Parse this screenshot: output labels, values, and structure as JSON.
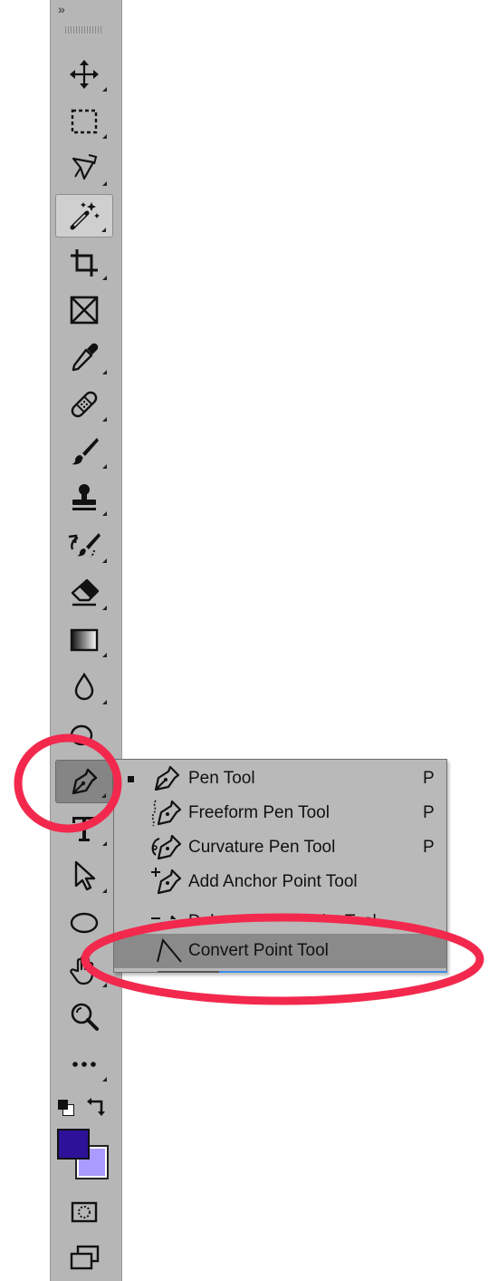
{
  "toolbar": {
    "collapse_label": "»",
    "tools": [
      {
        "name": "move-tool",
        "icon": "move-icon"
      },
      {
        "name": "rectangular-marquee-tool",
        "icon": "marquee-icon"
      },
      {
        "name": "lasso-tool",
        "icon": "lasso-icon"
      },
      {
        "name": "magic-wand-tool",
        "icon": "magic-wand-icon",
        "state": "active"
      },
      {
        "name": "crop-tool",
        "icon": "crop-icon"
      },
      {
        "name": "frame-tool",
        "icon": "frame-icon"
      },
      {
        "name": "eyedropper-tool",
        "icon": "eyedropper-icon"
      },
      {
        "name": "healing-brush-tool",
        "icon": "bandage-icon"
      },
      {
        "name": "brush-tool",
        "icon": "brush-icon"
      },
      {
        "name": "clone-stamp-tool",
        "icon": "stamp-icon"
      },
      {
        "name": "history-brush-tool",
        "icon": "history-brush-icon"
      },
      {
        "name": "eraser-tool",
        "icon": "eraser-icon"
      },
      {
        "name": "gradient-tool",
        "icon": "gradient-icon"
      },
      {
        "name": "blur-tool",
        "icon": "drop-icon"
      },
      {
        "name": "dodge-tool",
        "icon": "dodge-icon"
      },
      {
        "name": "pen-tool",
        "icon": "pen-icon",
        "state": "pressed"
      },
      {
        "name": "type-tool",
        "icon": "type-icon"
      },
      {
        "name": "path-selection-tool",
        "icon": "arrow-icon"
      },
      {
        "name": "ellipse-tool",
        "icon": "ellipse-icon"
      },
      {
        "name": "hand-tool",
        "icon": "hand-icon"
      },
      {
        "name": "zoom-tool",
        "icon": "zoom-icon"
      },
      {
        "name": "edit-toolbar",
        "icon": "more-icon"
      }
    ],
    "foreground_color": "#2e1199",
    "background_color": "#a99bff"
  },
  "flyout": {
    "items": [
      {
        "label": "Pen Tool",
        "shortcut": "P",
        "icon": "pen-icon",
        "selected": true
      },
      {
        "label": "Freeform Pen Tool",
        "shortcut": "P",
        "icon": "freeform-pen-icon"
      },
      {
        "label": "Curvature Pen Tool",
        "shortcut": "P",
        "icon": "curvature-pen-icon"
      },
      {
        "label": "Add Anchor Point Tool",
        "shortcut": "",
        "icon": "add-anchor-icon"
      },
      {
        "label": "Delete Anchor Point Tool",
        "shortcut": "",
        "icon": "delete-anchor-icon"
      },
      {
        "label": "Convert Point Tool",
        "shortcut": "",
        "icon": "convert-point-icon",
        "highlighted": true
      }
    ]
  },
  "annotations": {
    "color": "#f2294d"
  }
}
